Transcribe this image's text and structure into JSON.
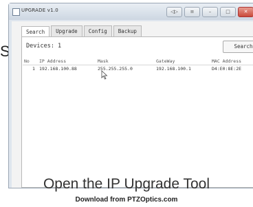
{
  "side_char": "S",
  "window": {
    "title": "UPGRADE v1.0",
    "buttons": [
      "◁▷",
      "≡",
      "–",
      "□",
      "✕"
    ]
  },
  "tabs": [
    {
      "label": "Search",
      "active": true
    },
    {
      "label": "Upgrade",
      "active": false
    },
    {
      "label": "Config",
      "active": false
    },
    {
      "label": "Backup",
      "active": false
    }
  ],
  "devices_label": "Devices: 1",
  "search_button": "Search",
  "table": {
    "headers": {
      "no": "No",
      "ip": "IP Address",
      "mask": "Mask",
      "gateway": "GateWay",
      "mac": "MAC Address"
    },
    "rows": [
      {
        "no": "1",
        "ip": "192.168.100.88",
        "mask": "255.255.255.0",
        "gateway": "192.168.100.1",
        "mac": "D4:E0:8E:2E"
      }
    ]
  },
  "caption": "Open the IP Upgrade Tool",
  "footer": "Download from PTZOptics.com"
}
